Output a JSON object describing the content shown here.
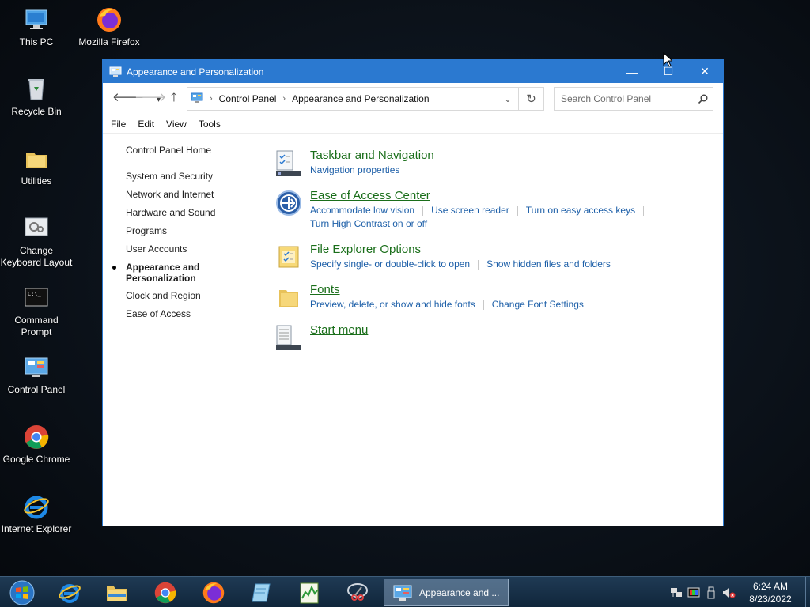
{
  "desktop": {
    "icons": [
      {
        "label": "This PC"
      },
      {
        "label": "Mozilla Firefox"
      },
      {
        "label": "Recycle Bin"
      },
      {
        "label": "Utilities"
      },
      {
        "label": "Change Keyboard Layout"
      },
      {
        "label": "Command Prompt"
      },
      {
        "label": "Control Panel"
      },
      {
        "label": "Google Chrome"
      },
      {
        "label": "Internet Explorer"
      }
    ]
  },
  "window": {
    "title": "Appearance and Personalization",
    "controls": {
      "minimize": "—",
      "maximize": "☐",
      "close": "✕"
    },
    "address": {
      "breadcrumbs": [
        "Control Panel",
        "Appearance and Personalization"
      ]
    },
    "search": {
      "placeholder": "Search Control Panel"
    },
    "menu": [
      "File",
      "Edit",
      "View",
      "Tools"
    ],
    "sidebar": {
      "home": "Control Panel Home",
      "items": [
        "System and Security",
        "Network and Internet",
        "Hardware and Sound",
        "Programs",
        "User Accounts",
        "Appearance and Personalization",
        "Clock and Region",
        "Ease of Access"
      ],
      "active_index": 5
    },
    "categories": [
      {
        "title": "Taskbar and Navigation",
        "links": [
          "Navigation properties"
        ]
      },
      {
        "title": "Ease of Access Center",
        "links": [
          "Accommodate low vision",
          "Use screen reader",
          "Turn on easy access keys",
          "Turn High Contrast on or off"
        ]
      },
      {
        "title": "File Explorer Options",
        "links": [
          "Specify single- or double-click to open",
          "Show hidden files and folders"
        ]
      },
      {
        "title": "Fonts",
        "links": [
          "Preview, delete, or show and hide fonts",
          "Change Font Settings"
        ]
      },
      {
        "title": "Start menu",
        "links": []
      }
    ]
  },
  "taskbar": {
    "active_window_label": "Appearance and ...",
    "clock": {
      "time": "6:24 AM",
      "date": "8/23/2022"
    }
  },
  "colors": {
    "titlebar": "#2b79d0",
    "category_title": "#1a6e1a",
    "link": "#1d5fa8"
  }
}
